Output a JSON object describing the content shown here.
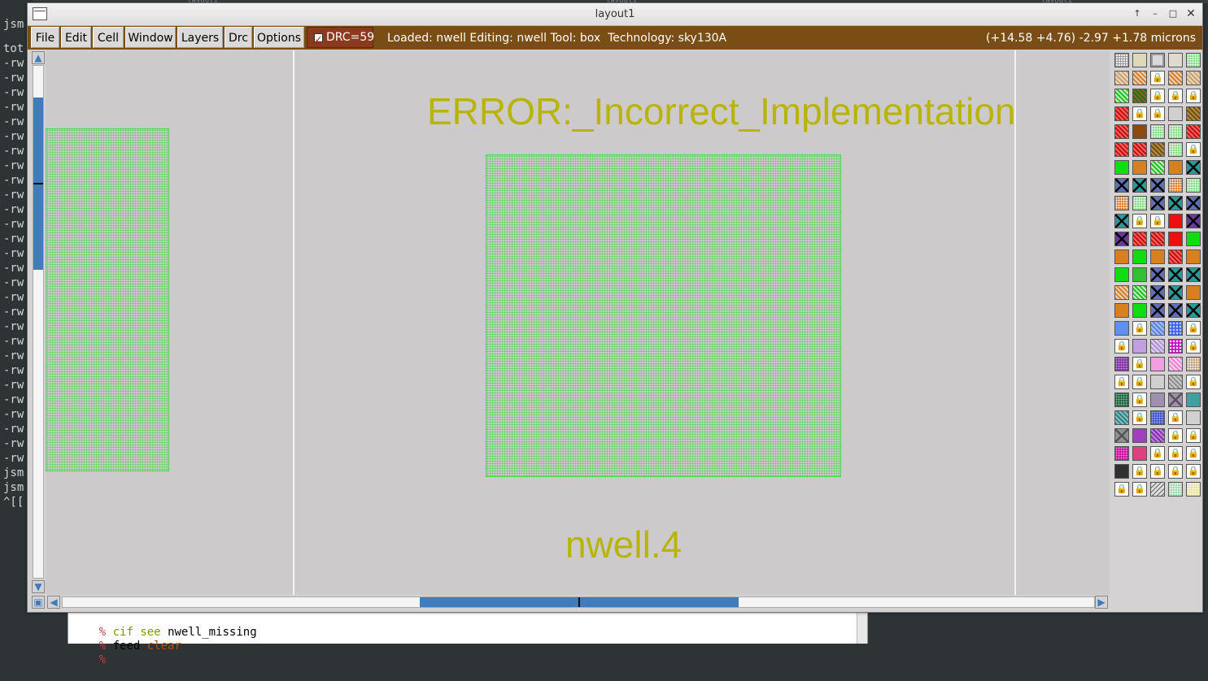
{
  "terminal": {
    "top_strip": [
      "layout1",
      "layout1",
      "layout1"
    ],
    "lines": [
      "jsm",
      "tot",
      "-rw",
      "-rw",
      "-rw",
      "-rw",
      "-rw",
      "-rw",
      "-rw",
      "-rw",
      "-rw",
      "-rw",
      "-rw",
      "-rw",
      "-rw",
      "-rw",
      "-rw",
      "-rw",
      "-rw",
      "-rw",
      "-rw",
      "-rw",
      "-rw",
      "-rw",
      "-rw",
      "-rw",
      "-rw",
      "-rw",
      "-rw",
      "-rw",
      "jsm",
      "jsm",
      "^[["
    ]
  },
  "console": {
    "lines": [
      {
        "prompt": "%",
        "cmd": "cif",
        "sub": "see",
        "arg": "nwell_missing"
      },
      {
        "prompt": "%",
        "cmd": "feed",
        "sub": "clear",
        "arg": ""
      },
      {
        "prompt": "%",
        "cmd": "",
        "sub": "",
        "arg": ""
      }
    ]
  },
  "window": {
    "title": "layout1",
    "controls": {
      "up": "↑",
      "min": "–",
      "max": "□",
      "close": "✕"
    }
  },
  "menu": {
    "items": [
      "File",
      "Edit",
      "Cell",
      "Window",
      "Layers",
      "Drc",
      "Options"
    ],
    "drc_label": "DRC=59",
    "drc_enabled": true,
    "status": "Loaded: nwell Editing: nwell Tool: box  Technology: sky130A",
    "coords": "(+14.58 +4.76) -2.97 +1.78 microns"
  },
  "canvas": {
    "error_label": "ERROR:_Incorrect_Implementation",
    "rule_label": "nwell.4",
    "colors": {
      "label": "#b8b400",
      "nwell": "#55d155",
      "background": "#cccacb"
    }
  },
  "scrollbars": {
    "vertical": {
      "position": 0.15,
      "extent": 0.34
    },
    "horizontal": {
      "position": 0.35,
      "extent": 0.31
    }
  },
  "palette": {
    "rows": [
      [
        "grid",
        "tan",
        "gray-box",
        "tan2",
        "green-dots"
      ],
      [
        "tan-hatch",
        "orange-hatch",
        "lock",
        "orange-hatch",
        "tan-hatch"
      ],
      [
        "green-hatch",
        "green-brown",
        "lock",
        "lock",
        "lock"
      ],
      [
        "red-hatch",
        "lock",
        "lock",
        "gray",
        "brown-hatch"
      ],
      [
        "red-hatch",
        "brown",
        "green-dots",
        "green-dots",
        "red-hatch"
      ],
      [
        "red-hatch",
        "red-hatch",
        "brown-hatch",
        "green-dots",
        "lock"
      ],
      [
        "green",
        "orange",
        "green-hatch",
        "orange",
        "teal-x"
      ],
      [
        "blue-x",
        "teal-x",
        "blue-x",
        "orange-dots",
        "green-dots"
      ],
      [
        "orange-dots",
        "green-dots",
        "blue-x",
        "teal-x",
        "blue-x"
      ],
      [
        "teal-x",
        "lock",
        "lock",
        "red",
        "purple-x"
      ],
      [
        "purple-x",
        "red-hatch",
        "red-hatch",
        "red",
        "green"
      ],
      [
        "orange",
        "green",
        "orange",
        "red-hatch",
        "orange"
      ],
      [
        "green",
        "green2",
        "blue-x",
        "teal-x",
        "teal-x"
      ],
      [
        "orange-hatch",
        "green-hatch",
        "blue-x",
        "teal-x",
        "orange"
      ],
      [
        "orange",
        "green",
        "blue-x",
        "blue-x",
        "teal-x"
      ],
      [
        "blue",
        "lock",
        "blue-hatch",
        "blue-check",
        "lock"
      ],
      [
        "lock",
        "lavender",
        "lavender-hatch",
        "magenta-check",
        "lock"
      ],
      [
        "purple-dots",
        "lock",
        "pink",
        "pink-hatch",
        "tan-dots"
      ],
      [
        "lock",
        "lock",
        "gray",
        "gray-hatch",
        "lock"
      ],
      [
        "dark-green-dots",
        "lock",
        "mauve",
        "mauve-x",
        "teal"
      ],
      [
        "teal-hatch",
        "lock",
        "blue-dots",
        "lock",
        "gray"
      ],
      [
        "gray-x",
        "purple",
        "purple-hatch",
        "lock",
        "lock"
      ],
      [
        "magenta-dots",
        "pink-solid",
        "lock",
        "lock",
        "lock"
      ],
      [
        "black",
        "lock",
        "lock",
        "lock",
        "lock"
      ],
      [
        "lock",
        "lock",
        "gray-lines",
        "pale-green",
        "pale-yellow"
      ]
    ]
  }
}
